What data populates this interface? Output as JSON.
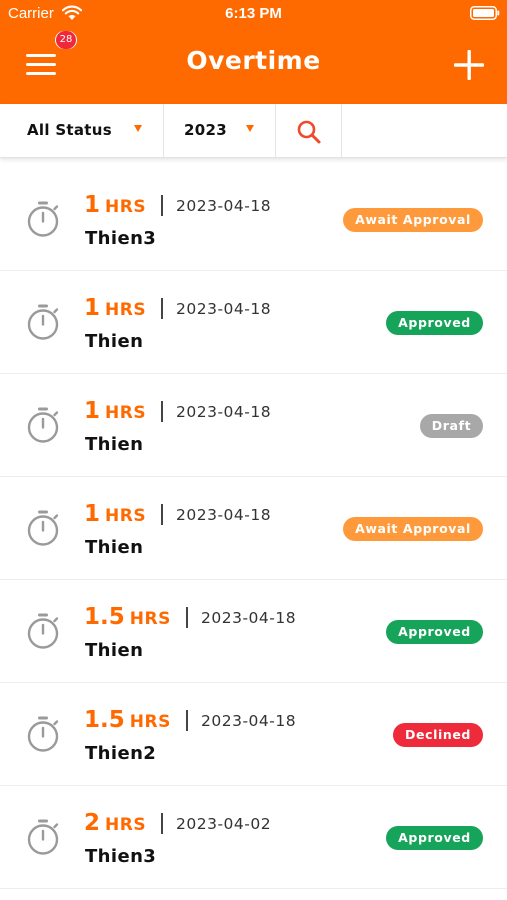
{
  "status_bar": {
    "carrier": "Carrier",
    "time": "6:13 PM"
  },
  "header": {
    "title": "Overtime",
    "notification_count": "28",
    "accent_color": "#FF6A00"
  },
  "filters": {
    "status": "All Status",
    "year": "2023"
  },
  "overtime_list": [
    {
      "hours": "1",
      "unit": "HRS",
      "date": "2023-04-18",
      "employee": "Thien3",
      "status": "Await Approval",
      "status_color": "#FF9A3C"
    },
    {
      "hours": "1",
      "unit": "HRS",
      "date": "2023-04-18",
      "employee": "Thien",
      "status": "Approved",
      "status_color": "#16A35A"
    },
    {
      "hours": "1",
      "unit": "HRS",
      "date": "2023-04-18",
      "employee": "Thien",
      "status": "Draft",
      "status_color": "#A8A8A8"
    },
    {
      "hours": "1",
      "unit": "HRS",
      "date": "2023-04-18",
      "employee": "Thien",
      "status": "Await Approval",
      "status_color": "#FF9A3C"
    },
    {
      "hours": "1.5",
      "unit": "HRS",
      "date": "2023-04-18",
      "employee": "Thien",
      "status": "Approved",
      "status_color": "#16A35A"
    },
    {
      "hours": "1.5",
      "unit": "HRS",
      "date": "2023-04-18",
      "employee": "Thien2",
      "status": "Declined",
      "status_color": "#EE2B3B"
    },
    {
      "hours": "2",
      "unit": "HRS",
      "date": "2023-04-02",
      "employee": "Thien3",
      "status": "Approved",
      "status_color": "#16A35A"
    }
  ]
}
